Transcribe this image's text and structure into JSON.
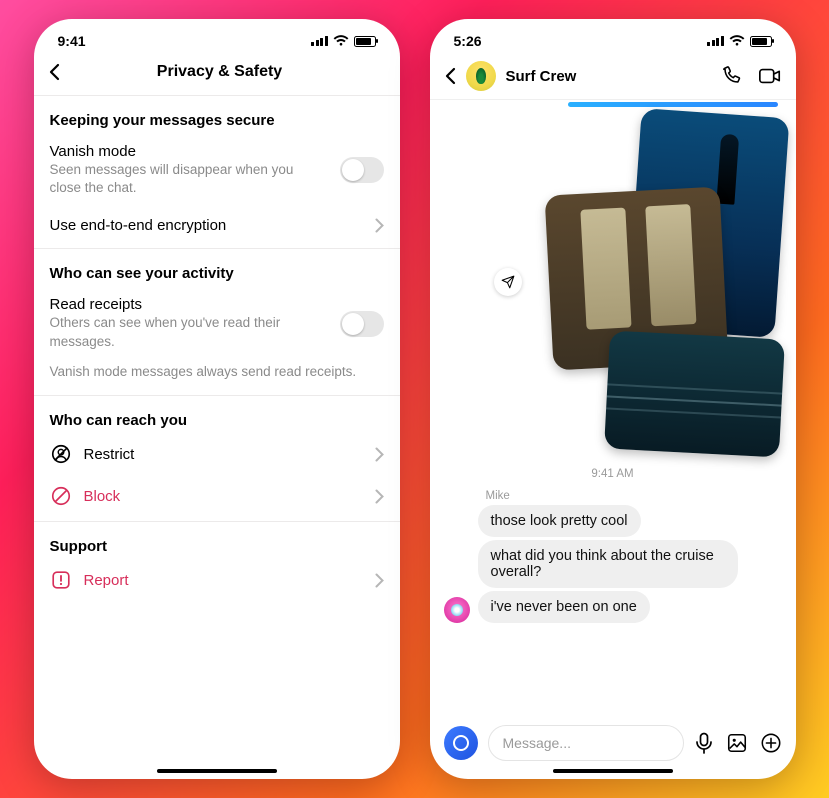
{
  "left": {
    "status_time": "9:41",
    "header_title": "Privacy & Safety",
    "sec1_title": "Keeping your messages secure",
    "vanish_title": "Vanish mode",
    "vanish_sub": "Seen messages will disappear when you close the chat.",
    "e2ee_title": "Use end-to-end encryption",
    "sec2_title": "Who can see your activity",
    "read_title": "Read receipts",
    "read_sub": "Others can see when you've read their messages.",
    "read_note": "Vanish mode messages always send read receipts.",
    "sec3_title": "Who can reach you",
    "restrict_label": "Restrict",
    "block_label": "Block",
    "sec4_title": "Support",
    "report_label": "Report"
  },
  "right": {
    "status_time": "5:26",
    "chat_title": "Surf Crew",
    "timestamp": "9:41 AM",
    "sender_name": "Mike",
    "msg1": "those look pretty cool",
    "msg2": "what did you think about the cruise overall?",
    "msg3": "i've never been on one",
    "composer_placeholder": "Message..."
  }
}
